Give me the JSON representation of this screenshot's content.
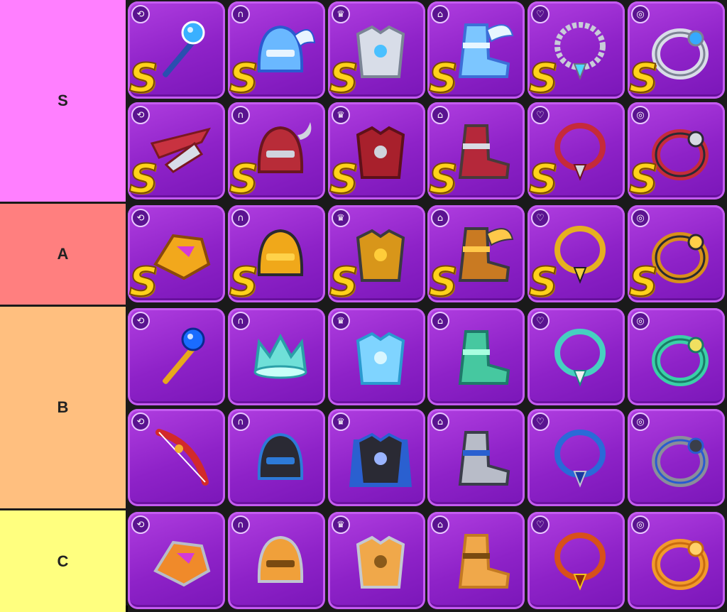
{
  "tiers": [
    {
      "label": "S",
      "color": "#ff7fff",
      "rows": [
        [
          {
            "slot": "weapon",
            "icon": "staff-icon",
            "grade": "S",
            "colors": [
              "#3ab0ff",
              "#2a4fb0",
              "#ffffff"
            ]
          },
          {
            "slot": "helmet",
            "icon": "winged-helmet-icon",
            "grade": "S",
            "colors": [
              "#6ab8ff",
              "#2a5ad0",
              "#e8f4ff"
            ]
          },
          {
            "slot": "armor",
            "icon": "chest-armor-icon",
            "grade": "S",
            "colors": [
              "#d8dde8",
              "#7b8596",
              "#4ac0ff"
            ]
          },
          {
            "slot": "boots",
            "icon": "winged-boots-icon",
            "grade": "S",
            "colors": [
              "#7cc6ff",
              "#3c6fd8",
              "#e8f6ff"
            ]
          },
          {
            "slot": "necklace",
            "icon": "chain-necklace-icon",
            "grade": "S",
            "colors": [
              "#c8ccd8",
              "#6d7080",
              "#4fd9ff"
            ]
          },
          {
            "slot": "ring",
            "icon": "ring-icon",
            "grade": "S",
            "colors": [
              "#d9dde8",
              "#7c8294",
              "#36a9ff"
            ]
          }
        ],
        [
          {
            "slot": "weapon",
            "icon": "crossbow-icon",
            "grade": "S",
            "colors": [
              "#c83240",
              "#7a1820",
              "#d8dde8"
            ]
          },
          {
            "slot": "helmet",
            "icon": "horned-helmet-icon",
            "grade": "S",
            "colors": [
              "#b82c38",
              "#6a1620",
              "#d0d4de"
            ]
          },
          {
            "slot": "armor",
            "icon": "chest-armor-icon",
            "grade": "S",
            "colors": [
              "#a8202c",
              "#5e101a",
              "#cfd3dc"
            ]
          },
          {
            "slot": "boots",
            "icon": "boots-icon",
            "grade": "S",
            "colors": [
              "#b5283a",
              "#4a3a3a",
              "#d8dbe4"
            ]
          },
          {
            "slot": "necklace",
            "icon": "necklace-icon",
            "grade": "S",
            "colors": [
              "#c62a3a",
              "#6e1420",
              "#d4d6de"
            ]
          },
          {
            "slot": "ring",
            "icon": "ring-icon",
            "grade": "S",
            "colors": [
              "#c52c3a",
              "#2a2a34",
              "#d6d9e2"
            ]
          }
        ]
      ]
    },
    {
      "label": "A",
      "color": "#ff7f7f",
      "rows": [
        [
          {
            "slot": "weapon",
            "icon": "gauntlet-icon",
            "grade": "S",
            "colors": [
              "#f2a81c",
              "#8a4a0a",
              "#d43ad8"
            ]
          },
          {
            "slot": "helmet",
            "icon": "helmet-icon",
            "grade": "S",
            "colors": [
              "#f0a81a",
              "#2a2a30",
              "#ffd24a"
            ]
          },
          {
            "slot": "armor",
            "icon": "chest-armor-icon",
            "grade": "S",
            "colors": [
              "#d8961a",
              "#3a3a40",
              "#ffcd3a"
            ]
          },
          {
            "slot": "boots",
            "icon": "winged-boots-icon",
            "grade": "S",
            "colors": [
              "#c97a22",
              "#3a3a40",
              "#ffc84a"
            ]
          },
          {
            "slot": "necklace",
            "icon": "necklace-icon",
            "grade": "S",
            "colors": [
              "#e6b020",
              "#1e1e24",
              "#f4d040"
            ]
          },
          {
            "slot": "ring",
            "icon": "ring-icon",
            "grade": "S",
            "colors": [
              "#d8901a",
              "#2a2a30",
              "#ffcf48"
            ]
          }
        ]
      ]
    },
    {
      "label": "B",
      "color": "#ffbf7f",
      "rows": [
        [
          {
            "slot": "weapon",
            "icon": "staff-icon",
            "grade": "",
            "colors": [
              "#1a6cff",
              "#e8a81c",
              "#0a2a90"
            ]
          },
          {
            "slot": "helmet",
            "icon": "crown-icon",
            "grade": "",
            "colors": [
              "#6fe0d8",
              "#2aa0a8",
              "#c8fff8"
            ]
          },
          {
            "slot": "armor",
            "icon": "chest-armor-icon",
            "grade": "",
            "colors": [
              "#7fd4ff",
              "#2a9ad0",
              "#d8f6ff"
            ]
          },
          {
            "slot": "boots",
            "icon": "boots-icon",
            "grade": "",
            "colors": [
              "#46c8a0",
              "#1e7a6a",
              "#a8ffe0"
            ]
          },
          {
            "slot": "necklace",
            "icon": "necklace-icon",
            "grade": "",
            "colors": [
              "#46d0c0",
              "#1a8a82",
              "#f0f0f0"
            ]
          },
          {
            "slot": "ring",
            "icon": "ring-icon",
            "grade": "",
            "colors": [
              "#3ad0a8",
              "#1a7a66",
              "#f0e060"
            ]
          }
        ],
        [
          {
            "slot": "weapon",
            "icon": "bow-icon",
            "grade": "",
            "colors": [
              "#d22a2a",
              "#f2b030",
              "#ffffff"
            ]
          },
          {
            "slot": "helmet",
            "icon": "mask-helmet-icon",
            "grade": "",
            "colors": [
              "#2a2a34",
              "#2d7ad8",
              "#6ab8ff"
            ]
          },
          {
            "slot": "armor",
            "icon": "cape-armor-icon",
            "grade": "",
            "colors": [
              "#2a2a34",
              "#2a60d0",
              "#9ab4ff"
            ]
          },
          {
            "slot": "boots",
            "icon": "boots-icon",
            "grade": "",
            "colors": [
              "#b8bcc8",
              "#3a3e4a",
              "#2a60d0"
            ]
          },
          {
            "slot": "necklace",
            "icon": "necklace-icon",
            "grade": "",
            "colors": [
              "#2a6ad8",
              "#c0c4d0",
              "#1a3aa0"
            ]
          },
          {
            "slot": "ring",
            "icon": "ring-icon",
            "grade": "",
            "colors": [
              "#8a8e9a",
              "#2a5ad0",
              "#3a3e4a"
            ]
          }
        ]
      ]
    },
    {
      "label": "C",
      "color": "#ffff7f",
      "rows": [
        [
          {
            "slot": "weapon",
            "icon": "gauntlet-icon",
            "grade": "",
            "colors": [
              "#f08a2a",
              "#b8bcc8",
              "#d43ad8"
            ]
          },
          {
            "slot": "helmet",
            "icon": "helmet-icon",
            "grade": "",
            "colors": [
              "#f0a03a",
              "#c0c4d0",
              "#7a4a10"
            ]
          },
          {
            "slot": "armor",
            "icon": "chest-armor-icon",
            "grade": "",
            "colors": [
              "#f0a84a",
              "#c4c8d2",
              "#8a5a1a"
            ]
          },
          {
            "slot": "boots",
            "icon": "boots-icon",
            "grade": "",
            "colors": [
              "#f0a84a",
              "#c47a22",
              "#7a4a10"
            ]
          },
          {
            "slot": "necklace",
            "icon": "necklace-icon",
            "grade": "",
            "colors": [
              "#d8501a",
              "#f2c21a",
              "#8a2a10"
            ]
          },
          {
            "slot": "ring",
            "icon": "ring-icon",
            "grade": "",
            "colors": [
              "#f29a2a",
              "#c86a10",
              "#ffd26a"
            ]
          }
        ]
      ]
    }
  ]
}
